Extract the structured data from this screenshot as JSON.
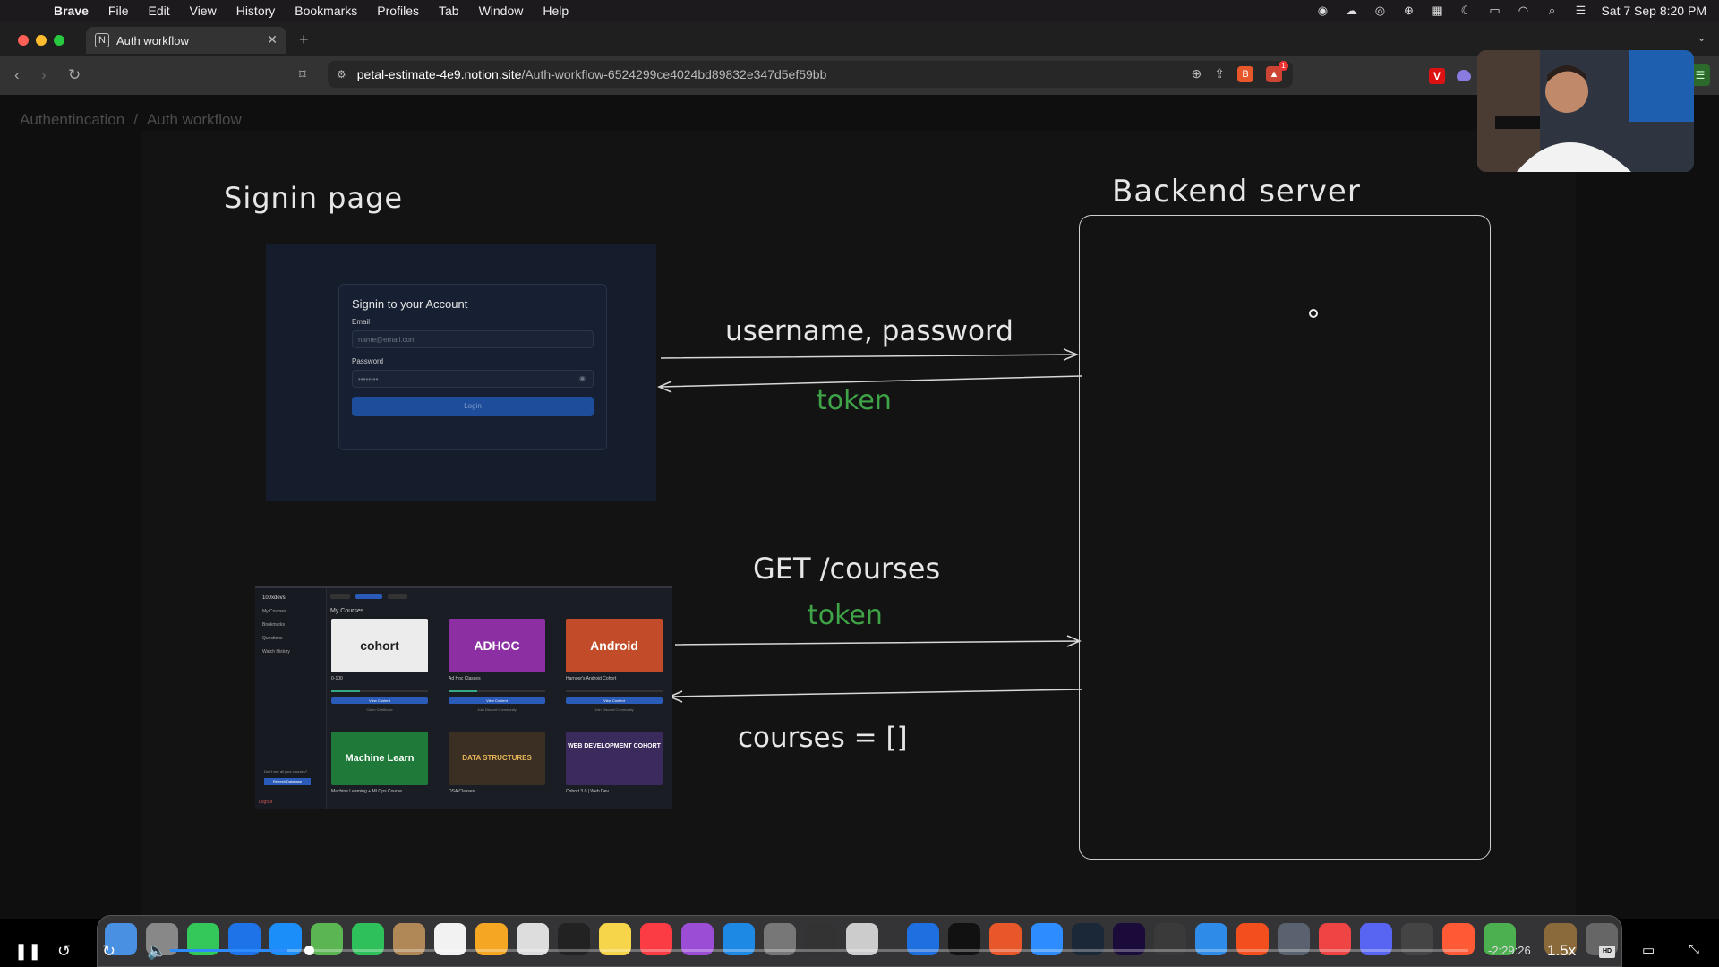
{
  "menubar": {
    "app": "Brave",
    "items": [
      "File",
      "Edit",
      "View",
      "History",
      "Bookmarks",
      "Profiles",
      "Tab",
      "Window",
      "Help"
    ],
    "datetime": "Sat 7 Sep  8:20 PM"
  },
  "tab": {
    "title": "Auth workflow",
    "favicon": "N"
  },
  "address": {
    "domain": "petal-estimate-4e9.notion.site",
    "path": "/Auth-workflow-6524299ce4024bd89832e347d5ef59bb"
  },
  "breadcrumb": [
    "Authentincation",
    "Auth workflow"
  ],
  "diagram": {
    "signin_title": "Signin page",
    "backend_title": "Backend server",
    "label_userpass": "username, password",
    "label_token1": "token",
    "label_get": "GET /courses",
    "label_token2": "token",
    "label_courses": "courses = []",
    "accent_green": "#3ea447"
  },
  "signin_form": {
    "title": "Signin to your Account",
    "email_label": "Email",
    "email_placeholder": "name@email.com",
    "password_label": "Password",
    "password_value": "••••••••",
    "login_button": "Login"
  },
  "courses_page": {
    "logo": "100xdevs",
    "sidebar": [
      "My Courses",
      "Bookmarks",
      "Questions",
      "Watch History"
    ],
    "sidebar_footer_text": "Don't see all your courses?",
    "sidebar_footer_button": "Refresh Database",
    "logout": "Logout",
    "header": "My Courses",
    "courses": [
      {
        "thumb": "cohort",
        "name": "0-100",
        "button": "View Content",
        "sub": "Claim Certificate"
      },
      {
        "thumb": "ADHOC",
        "name": "Ad Hoc Classes",
        "button": "View Content",
        "sub": "Join Discord Community"
      },
      {
        "thumb": "Android",
        "name": "Harnoor's Android Cohort",
        "button": "View Content",
        "sub": "Join Discord Community"
      },
      {
        "thumb": "Machine Learn",
        "name": "Machine Learning + MLOps Course"
      },
      {
        "thumb": "DATA STRUCTURES",
        "name": "DSA Classes"
      },
      {
        "thumb": "WEB DEVELOPMENT COHORT",
        "name": "Cohort 3.0 | Web Dev"
      }
    ]
  },
  "video": {
    "time": "-2:29:26",
    "speed": "1.5x",
    "progress": 0.09,
    "hd_label": "HD"
  }
}
